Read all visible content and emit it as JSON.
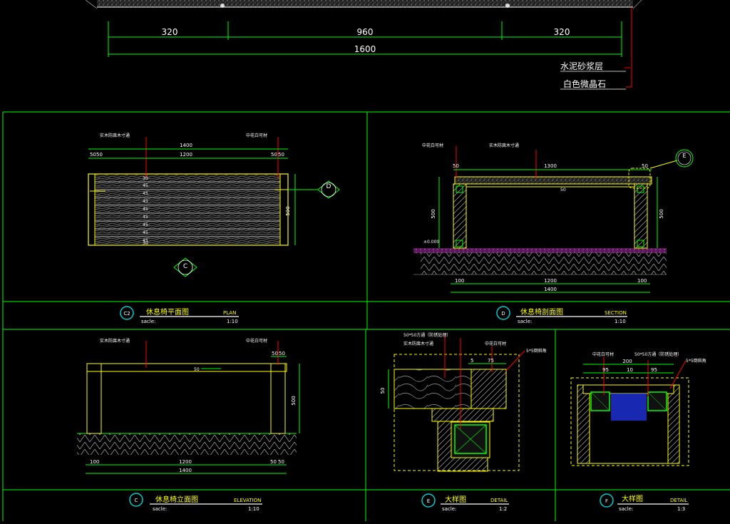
{
  "top": {
    "dims": [
      "320",
      "960",
      "320"
    ],
    "total": "1600",
    "notes": [
      "水泥砂浆层",
      "白色微晶石"
    ]
  },
  "plan": {
    "callouts": [
      "实木防腐木寸通",
      "中花白可材"
    ],
    "top_dims": [
      "50",
      "50",
      "1400",
      "1200",
      "50",
      "50"
    ],
    "slat_dims": [
      "30",
      "45",
      "45",
      "45",
      "45",
      "45",
      "45",
      "45",
      "45",
      "30"
    ],
    "side_dim": "500",
    "section_mark": "D",
    "elev_mark": "C",
    "title_no": "C2",
    "title": "休息椅平面图",
    "title_en": "PLAN",
    "scale_label": "sacle:",
    "scale": "1:10"
  },
  "section": {
    "callouts": [
      "中花白可材",
      "实木防腐木寸通"
    ],
    "dims": [
      "50",
      "1300",
      "50",
      "500",
      "500",
      "100",
      "1200",
      "100",
      "1400"
    ],
    "beam_label": "50",
    "level": "±0.000",
    "detail_mark": "E",
    "title_no": "D",
    "title": "休息椅剖面图",
    "title_en": "SECTION",
    "scale_label": "sacle:",
    "scale": "1:10"
  },
  "elevation": {
    "callouts": [
      "实木防腐木寸通",
      "中花白可材"
    ],
    "dims": [
      "50",
      "50",
      "50",
      "500",
      "100",
      "1200",
      "50",
      "50",
      "1400"
    ],
    "title_no": "C",
    "title": "休息椅立面图",
    "title_en": "ELEVATION",
    "scale_label": "sacle:",
    "scale": "1:10"
  },
  "detail_e": {
    "callouts": [
      "50*50方通（防锈处理）",
      "实木防腐木寸通",
      "中花白可材",
      "5*5倒斜角"
    ],
    "dims": [
      "5",
      "75",
      "50"
    ],
    "title_no": "E",
    "title": "大样图",
    "title_en": "DETAIL",
    "scale_label": "sacle:",
    "scale": "1:2"
  },
  "detail_f": {
    "callouts": [
      "中花白可材",
      "50*50方通（防锈处理）",
      "5*5倒斜角"
    ],
    "dims": [
      "200",
      "95",
      "10",
      "95"
    ],
    "title_no": "F",
    "title": "大样图",
    "title_en": "DETAIL",
    "scale_label": "sacle:",
    "scale": "1:3"
  },
  "colors": {
    "background": "#000000",
    "frame": "#00ff00",
    "outline": "#ffff00",
    "leader": "#ff0000",
    "text": "#ffffff",
    "wood": "#9a9a9a",
    "marker": "#00cccc",
    "ground": "#cc55cc",
    "steel": "#1c2fd0"
  }
}
